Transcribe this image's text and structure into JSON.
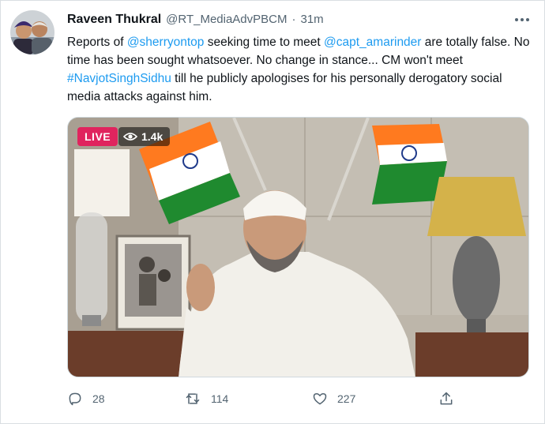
{
  "author": {
    "name": "Raveen Thukral",
    "handle": "@RT_MediaAdvPBCM",
    "separator": "·",
    "time": "31m"
  },
  "tweet": {
    "t1": "Reports of ",
    "m1": "@sherryontop",
    "t2": " seeking time to meet ",
    "m2": "@capt_amarinder",
    "t3": " are totally false. No time has been sought whatsoever. No change in stance... CM won't meet ",
    "h1": "#NavjotSinghSidhu",
    "t4": " till he publicly apologises for his personally derogatory social media attacks against him."
  },
  "media": {
    "live_label": "LIVE",
    "viewer_count": "1.4k"
  },
  "stats": {
    "replies": "28",
    "retweets": "114",
    "likes": "227"
  },
  "icons": {
    "more": "more-dots-icon",
    "reply": "reply-icon",
    "retweet": "retweet-icon",
    "like": "heart-icon",
    "share": "share-icon",
    "viewers": "eye-icon"
  },
  "colors": {
    "link": "#1d9bf0",
    "live": "#e0245e",
    "secondary_text": "#536471"
  }
}
